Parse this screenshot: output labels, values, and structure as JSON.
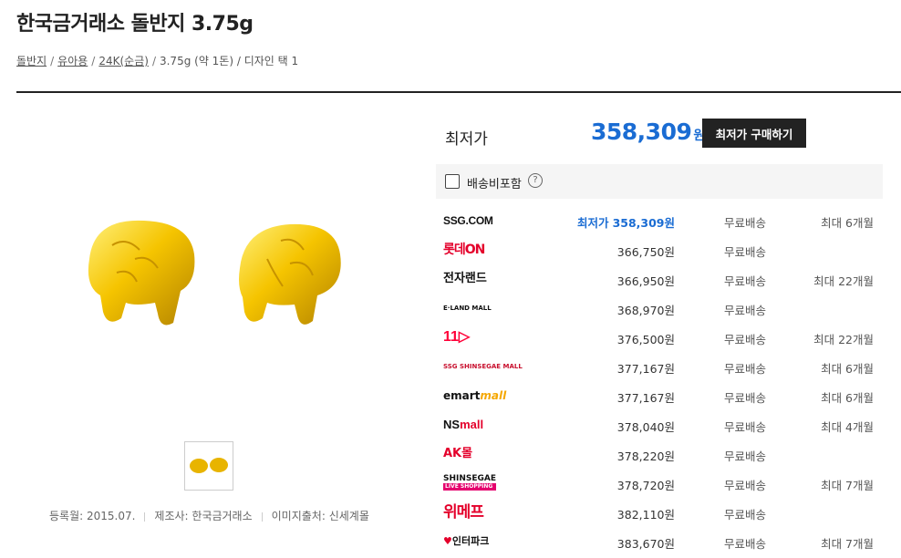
{
  "product": {
    "title": "한국금거래소 돌반지 3.75g"
  },
  "breadcrumb": {
    "links": [
      "돌반지",
      "유아용",
      "24K(순금)"
    ],
    "tail": "3.75g (약 1돈) / 디자인 택 1"
  },
  "gallery": {
    "registered": "등록월: 2015.07.",
    "maker": "제조사: 한국금거래소",
    "image_source": "이미지출처: 신세계몰"
  },
  "best": {
    "label": "최저가",
    "price": "358,309",
    "unit": "원",
    "buy_button": "최저가 구매하기"
  },
  "shipping_filter": {
    "label": "배송비포함",
    "help": "?"
  },
  "offers": [
    {
      "logo_icon": "ssg-logo",
      "logo_text": "SSG.COM",
      "price_prefix": "최저가",
      "price": "358,309원",
      "shipping": "무료배송",
      "installment": "최대 6개월"
    },
    {
      "logo_icon": "lotte-on-logo",
      "logo_text": "롯데ON",
      "price": "366,750원",
      "shipping": "무료배송",
      "installment": ""
    },
    {
      "logo_icon": "electroland-logo",
      "logo_text": "전자랜드",
      "price": "366,950원",
      "shipping": "무료배송",
      "installment": "최대 22개월"
    },
    {
      "logo_icon": "eland-mall-logo",
      "logo_text": "E·LAND MALL",
      "price": "368,970원",
      "shipping": "무료배송",
      "installment": ""
    },
    {
      "logo_icon": "11st-logo",
      "logo_text": "11▷",
      "price": "376,500원",
      "shipping": "무료배송",
      "installment": "최대 22개월"
    },
    {
      "logo_icon": "shinsegae-mall-logo",
      "logo_text": "SSG SHINSEGAE MALL",
      "price": "377,167원",
      "shipping": "무료배송",
      "installment": "최대 6개월"
    },
    {
      "logo_icon": "emart-mall-logo",
      "logo_text": "emart",
      "logo_text2": "mall",
      "price": "377,167원",
      "shipping": "무료배송",
      "installment": "최대 6개월"
    },
    {
      "logo_icon": "ns-mall-logo",
      "logo_text": "NS",
      "logo_text2": "mall",
      "price": "378,040원",
      "shipping": "무료배송",
      "installment": "최대 4개월"
    },
    {
      "logo_icon": "ak-mall-logo",
      "logo_text": "AK몰",
      "price": "378,220원",
      "shipping": "무료배송",
      "installment": ""
    },
    {
      "logo_icon": "shinsegae-live-logo",
      "logo_text": "SHINSEGAE",
      "logo_text2": "LIVE SHOPPING",
      "price": "378,720원",
      "shipping": "무료배송",
      "installment": "최대 7개월"
    },
    {
      "logo_icon": "wemakeprice-logo",
      "logo_text": "위메프",
      "price": "382,110원",
      "shipping": "무료배송",
      "installment": ""
    },
    {
      "logo_icon": "interpark-logo",
      "logo_text": "인터파크",
      "price": "383,670원",
      "shipping": "무료배송",
      "installment": "최대 7개월"
    }
  ],
  "colors": {
    "accent": "#1a6cd3",
    "gold": "#f2c200",
    "dark": "#222222"
  }
}
